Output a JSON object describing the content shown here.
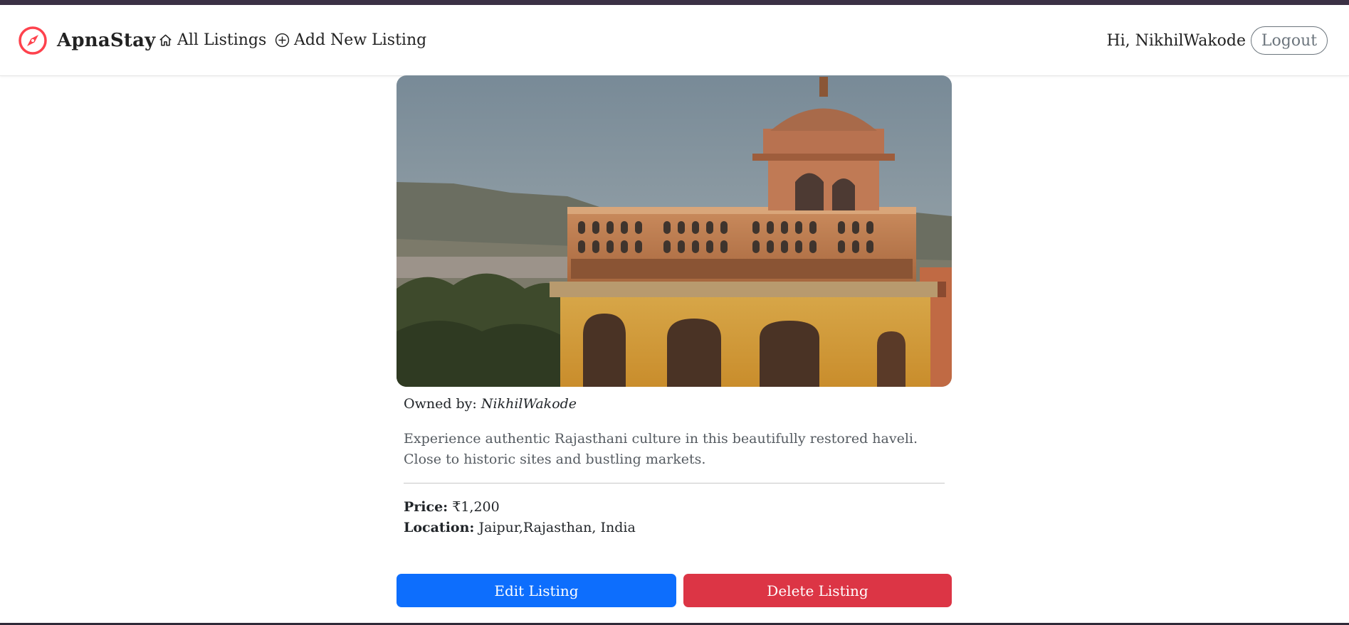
{
  "brand": {
    "name": "ApnaStay",
    "color": "#fe424d",
    "icon": "compass-icon"
  },
  "nav": {
    "all_listings": {
      "label": "All Listings",
      "icon": "home-icon"
    },
    "add_listing": {
      "label": "Add New Listing",
      "icon": "plus-circle-icon"
    },
    "greeting": "Hi, NikhilWakode",
    "logout": "Logout"
  },
  "listing": {
    "owner_label": "Owned by:",
    "owner_name": "NikhilWakode",
    "description": "Experience authentic Rajasthani culture in this beautifully restored haveli. Close to historic sites and bustling markets.",
    "price_label": "Price:",
    "price": "₹1,200",
    "location_label": "Location:",
    "location": "Jaipur,Rajasthan, India"
  },
  "actions": {
    "edit": "Edit Listing",
    "delete": "Delete Listing",
    "edit_color": "#0d6efd",
    "delete_color": "#dc3545"
  }
}
